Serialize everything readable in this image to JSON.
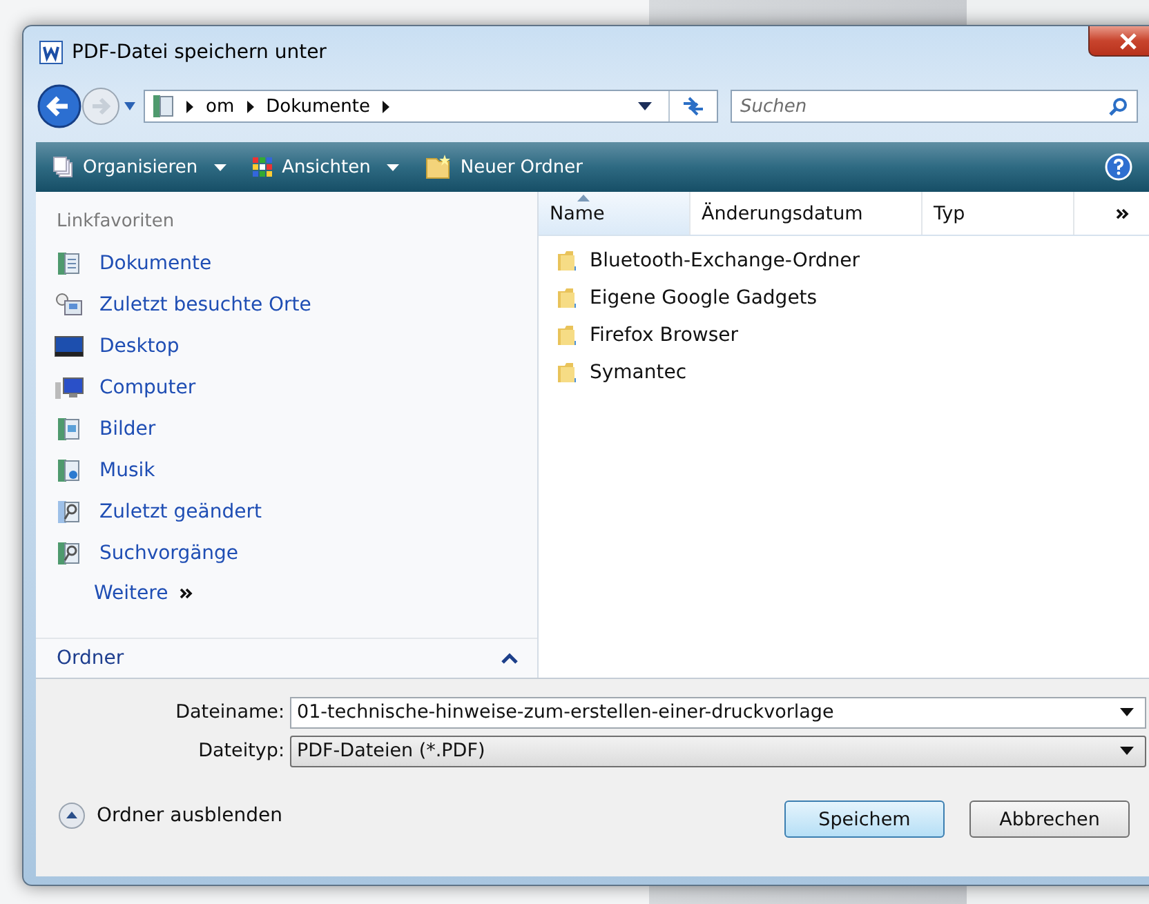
{
  "window": {
    "title": "PDF-Datei speichern unter"
  },
  "address": {
    "crumbs": [
      "om",
      "Dokumente"
    ]
  },
  "search": {
    "placeholder": "Suchen"
  },
  "toolbar": {
    "items": [
      "Organisieren",
      "Ansichten",
      "Neuer Ordner"
    ]
  },
  "sidebar": {
    "heading": "Linkfavoriten",
    "items": [
      "Dokumente",
      "Zuletzt besuchte Orte",
      "Desktop",
      "Computer",
      "Bilder",
      "Musik",
      "Zuletzt geändert",
      "Suchvorgänge"
    ],
    "more": "Weitere",
    "folders": "Ordner"
  },
  "table": {
    "columns": [
      {
        "label": "Name",
        "sorted": true
      },
      {
        "label": "Änderungsdatum",
        "sorted": false
      },
      {
        "label": "Typ",
        "sorted": false
      }
    ],
    "rows": [
      "Bluetooth-Exchange-Ordner",
      "Eigene Google Gadgets",
      "Firefox Browser",
      "Symantec"
    ]
  },
  "form": {
    "filename_label": "Dateiname:",
    "filename": "01-technische-hinweise-zum-erstellen-einer-druckvorlage",
    "filetype_label": "Dateityp:",
    "filetype": "PDF-Dateien (*.PDF)"
  },
  "footer": {
    "toggle": "Ordner ausblenden",
    "buttons": [
      "Speichem",
      "Abbrechen"
    ]
  }
}
